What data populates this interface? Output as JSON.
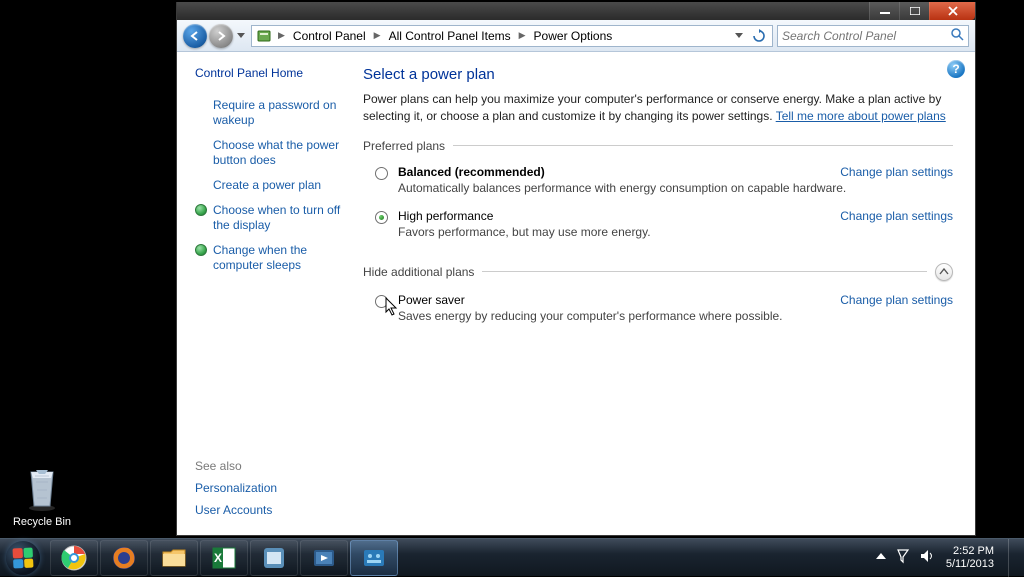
{
  "desktop": {
    "recycle_bin": "Recycle Bin"
  },
  "window": {
    "breadcrumbs": [
      "Control Panel",
      "All Control Panel Items",
      "Power Options"
    ],
    "search_placeholder": "Search Control Panel"
  },
  "sidebar": {
    "home": "Control Panel Home",
    "links": [
      "Require a password on wakeup",
      "Choose what the power button does",
      "Create a power plan",
      "Choose when to turn off the display",
      "Change when the computer sleeps"
    ],
    "see_also_label": "See also",
    "see_also": [
      "Personalization",
      "User Accounts"
    ]
  },
  "main": {
    "title": "Select a power plan",
    "intro_text": "Power plans can help you maximize your computer's performance or conserve energy. Make a plan active by selecting it, or choose a plan and customize it by changing its power settings. ",
    "intro_link": "Tell me more about power plans",
    "section_preferred": "Preferred plans",
    "section_additional": "Hide additional plans",
    "change_link": "Change plan settings",
    "plans": [
      {
        "name": "Balanced (recommended)",
        "desc": "Automatically balances performance with energy consumption on capable hardware.",
        "selected": false,
        "bold": true
      },
      {
        "name": "High performance",
        "desc": "Favors performance, but may use more energy.",
        "selected": true,
        "bold": false
      }
    ],
    "additional_plans": [
      {
        "name": "Power saver",
        "desc": "Saves energy by reducing your computer's performance where possible.",
        "selected": false,
        "bold": false
      }
    ]
  },
  "tray": {
    "time": "2:52 PM",
    "date": "5/11/2013"
  }
}
